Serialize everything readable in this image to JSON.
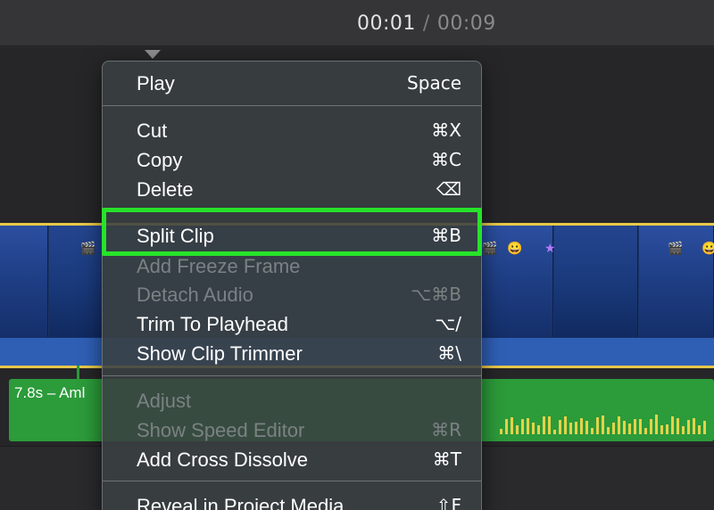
{
  "timecode": {
    "current": "00:01",
    "separator": "/",
    "total": "00:09"
  },
  "audio_clip": {
    "title": "7.8s – Aml"
  },
  "context_menu": {
    "items": [
      {
        "label": "Play",
        "shortcut": "Space",
        "enabled": true
      },
      {
        "label": "Cut",
        "shortcut": "⌘X",
        "enabled": true
      },
      {
        "label": "Copy",
        "shortcut": "⌘C",
        "enabled": true
      },
      {
        "label": "Delete",
        "shortcut": "⌫",
        "enabled": true
      },
      {
        "label": "Split Clip",
        "shortcut": "⌘B",
        "enabled": true,
        "highlighted": true
      },
      {
        "label": "Add Freeze Frame",
        "shortcut": "",
        "enabled": false
      },
      {
        "label": "Detach Audio",
        "shortcut": "⌥⌘B",
        "enabled": false
      },
      {
        "label": "Trim To Playhead",
        "shortcut": "⌥/",
        "enabled": true
      },
      {
        "label": "Show Clip Trimmer",
        "shortcut": "⌘\\",
        "enabled": true
      },
      {
        "label": "Adjust",
        "shortcut": "",
        "enabled": false
      },
      {
        "label": "Show Speed Editor",
        "shortcut": "⌘R",
        "enabled": false
      },
      {
        "label": "Add Cross Dissolve",
        "shortcut": "⌘T",
        "enabled": true
      },
      {
        "label": "Reveal in Project Media",
        "shortcut": "⇧F",
        "enabled": true
      }
    ]
  },
  "colors": {
    "highlight_border": "#27e32a",
    "video_clip_border": "#e8c84a",
    "audio_clip": "#2c9b3a",
    "waveform": "#e3d34a"
  }
}
